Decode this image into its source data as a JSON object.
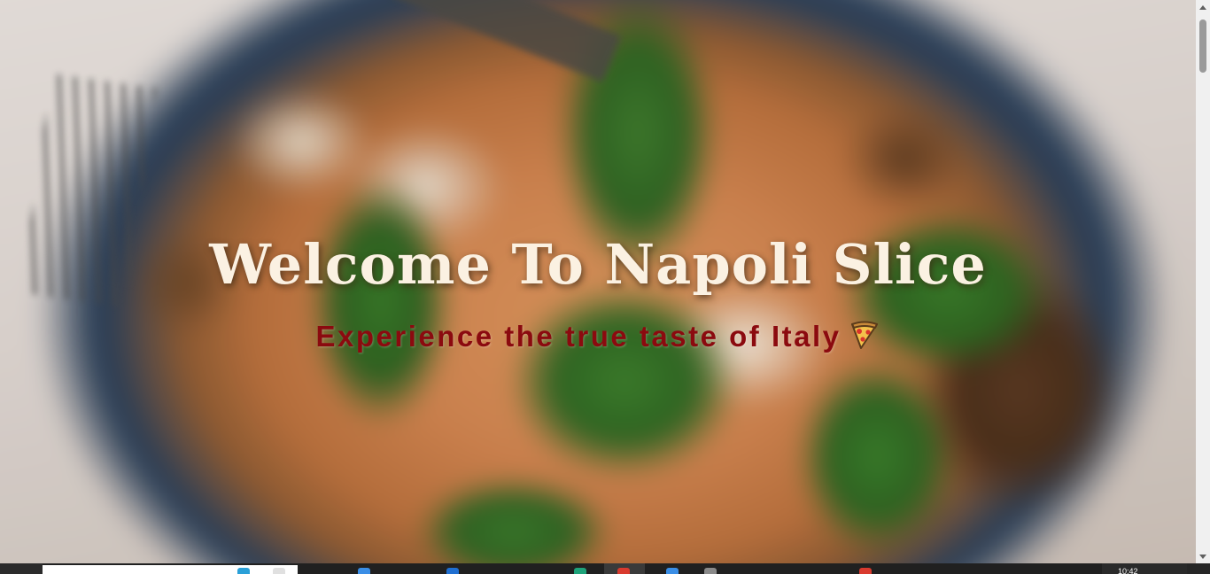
{
  "hero": {
    "title": "Welcome To Napoli Slice",
    "subtitle": "Experience the true taste of Italy",
    "subtitle_icon": "pizza-slice-icon",
    "background_icon": "pizza-photo"
  },
  "colors": {
    "title": "#fbf1e2",
    "subtitle": "#8b0a0f",
    "scrollbar_track": "#f0f0f0",
    "scrollbar_thumb": "#9a9a9a",
    "taskbar": "#202020"
  },
  "taskbar": {
    "clock": "10:42"
  }
}
